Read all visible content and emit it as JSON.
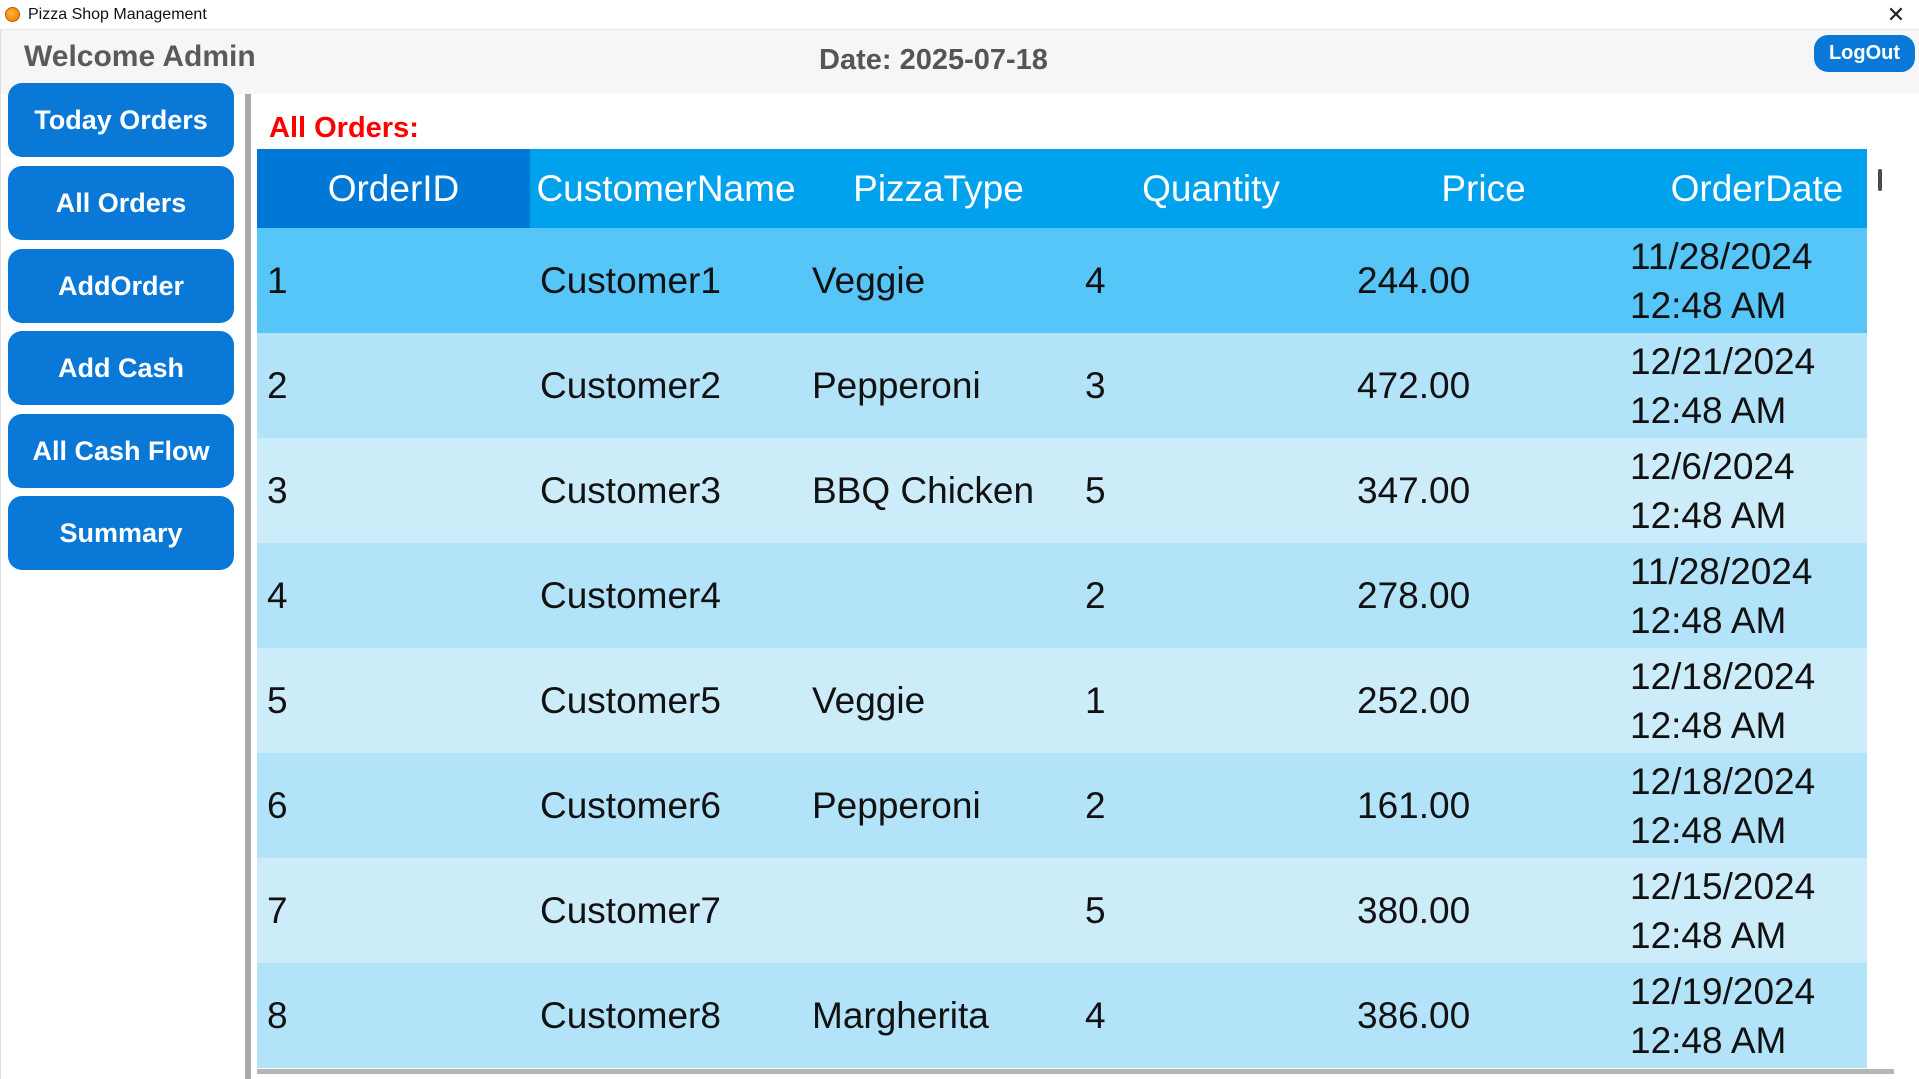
{
  "window": {
    "title": "Pizza Shop Management",
    "close_glyph": "✕",
    "icon": "pizza-app-icon"
  },
  "header": {
    "welcome": "Welcome Admin",
    "date": "Date: 2025-07-18",
    "logout_label": "LogOut"
  },
  "sidebar": {
    "items": [
      {
        "label": "Today Orders"
      },
      {
        "label": "All Orders"
      },
      {
        "label": "AddOrder"
      },
      {
        "label": "Add Cash"
      },
      {
        "label": "All Cash Flow"
      },
      {
        "label": "Summary"
      }
    ]
  },
  "main": {
    "section_title": "All Orders:",
    "columns": [
      "OrderID",
      "CustomerName",
      "PizzaType",
      "Quantity",
      "Price",
      "OrderDate"
    ],
    "rows": [
      {
        "id": "1",
        "customer": "Customer1",
        "pizza": "Veggie",
        "qty": "4",
        "price": "244.00",
        "date": "11/28/2024",
        "time": "12:48 AM"
      },
      {
        "id": "2",
        "customer": "Customer2",
        "pizza": "Pepperoni",
        "qty": "3",
        "price": "472.00",
        "date": "12/21/2024",
        "time": "12:48 AM"
      },
      {
        "id": "3",
        "customer": "Customer3",
        "pizza": "BBQ Chicken",
        "qty": "5",
        "price": "347.00",
        "date": "12/6/2024",
        "time": "12:48 AM"
      },
      {
        "id": "4",
        "customer": "Customer4",
        "pizza": "",
        "qty": "2",
        "price": "278.00",
        "date": "11/28/2024",
        "time": "12:48 AM"
      },
      {
        "id": "5",
        "customer": "Customer5",
        "pizza": "Veggie",
        "qty": "1",
        "price": "252.00",
        "date": "12/18/2024",
        "time": "12:48 AM"
      },
      {
        "id": "6",
        "customer": "Customer6",
        "pizza": "Pepperoni",
        "qty": "2",
        "price": "161.00",
        "date": "12/18/2024",
        "time": "12:48 AM"
      },
      {
        "id": "7",
        "customer": "Customer7",
        "pizza": "",
        "qty": "5",
        "price": "380.00",
        "date": "12/15/2024",
        "time": "12:48 AM"
      },
      {
        "id": "8",
        "customer": "Customer8",
        "pizza": "Margherita",
        "qty": "4",
        "price": "386.00",
        "date": "12/19/2024",
        "time": "12:48 AM"
      }
    ]
  },
  "colors": {
    "accent_button": "#0a78d6",
    "grid_header": "#00a2ed",
    "header_selected": "#0078d7",
    "row_selected": "#56c5f8",
    "row_even": "#b3e3f8",
    "row_odd": "#cdecfa",
    "section_title": "#ff0000"
  }
}
